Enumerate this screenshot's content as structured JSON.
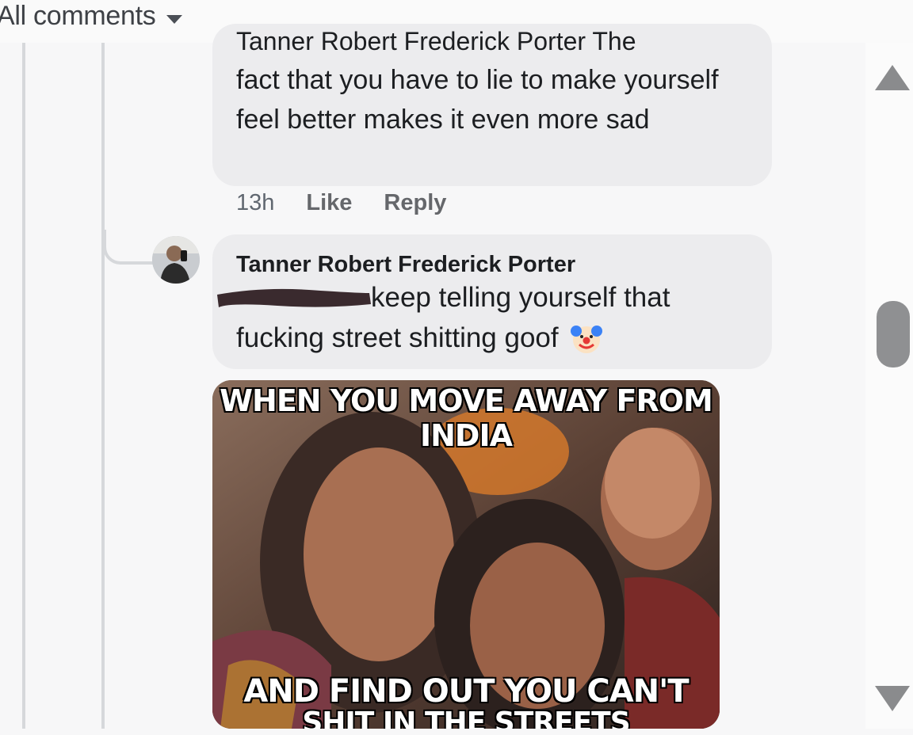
{
  "header": {
    "filter_label": "All comments",
    "caret_icon": "caret-down-icon"
  },
  "comments": [
    {
      "clipped_line": "Tanner Robert Frederick Porter The",
      "text": "fact that you have to lie to make yourself feel better makes it even more sad",
      "time": "13h",
      "like_label": "Like",
      "reply_label": "Reply"
    },
    {
      "author": "Tanner Robert Frederick Porter",
      "line1": "keep telling yourself that",
      "line2": "fucking street shitting goof",
      "emoji": "clown-face-icon",
      "attachment": {
        "caption_top": "WHEN YOU MOVE AWAY FROM INDIA",
        "caption_bottom": "AND FIND OUT YOU CAN'T",
        "caption_bottom_cut": "SHIT IN THE STREETS"
      }
    }
  ],
  "colors": {
    "bubble": "#ececee",
    "thread_line": "#d6d8db",
    "scroll": "#8f9092"
  }
}
